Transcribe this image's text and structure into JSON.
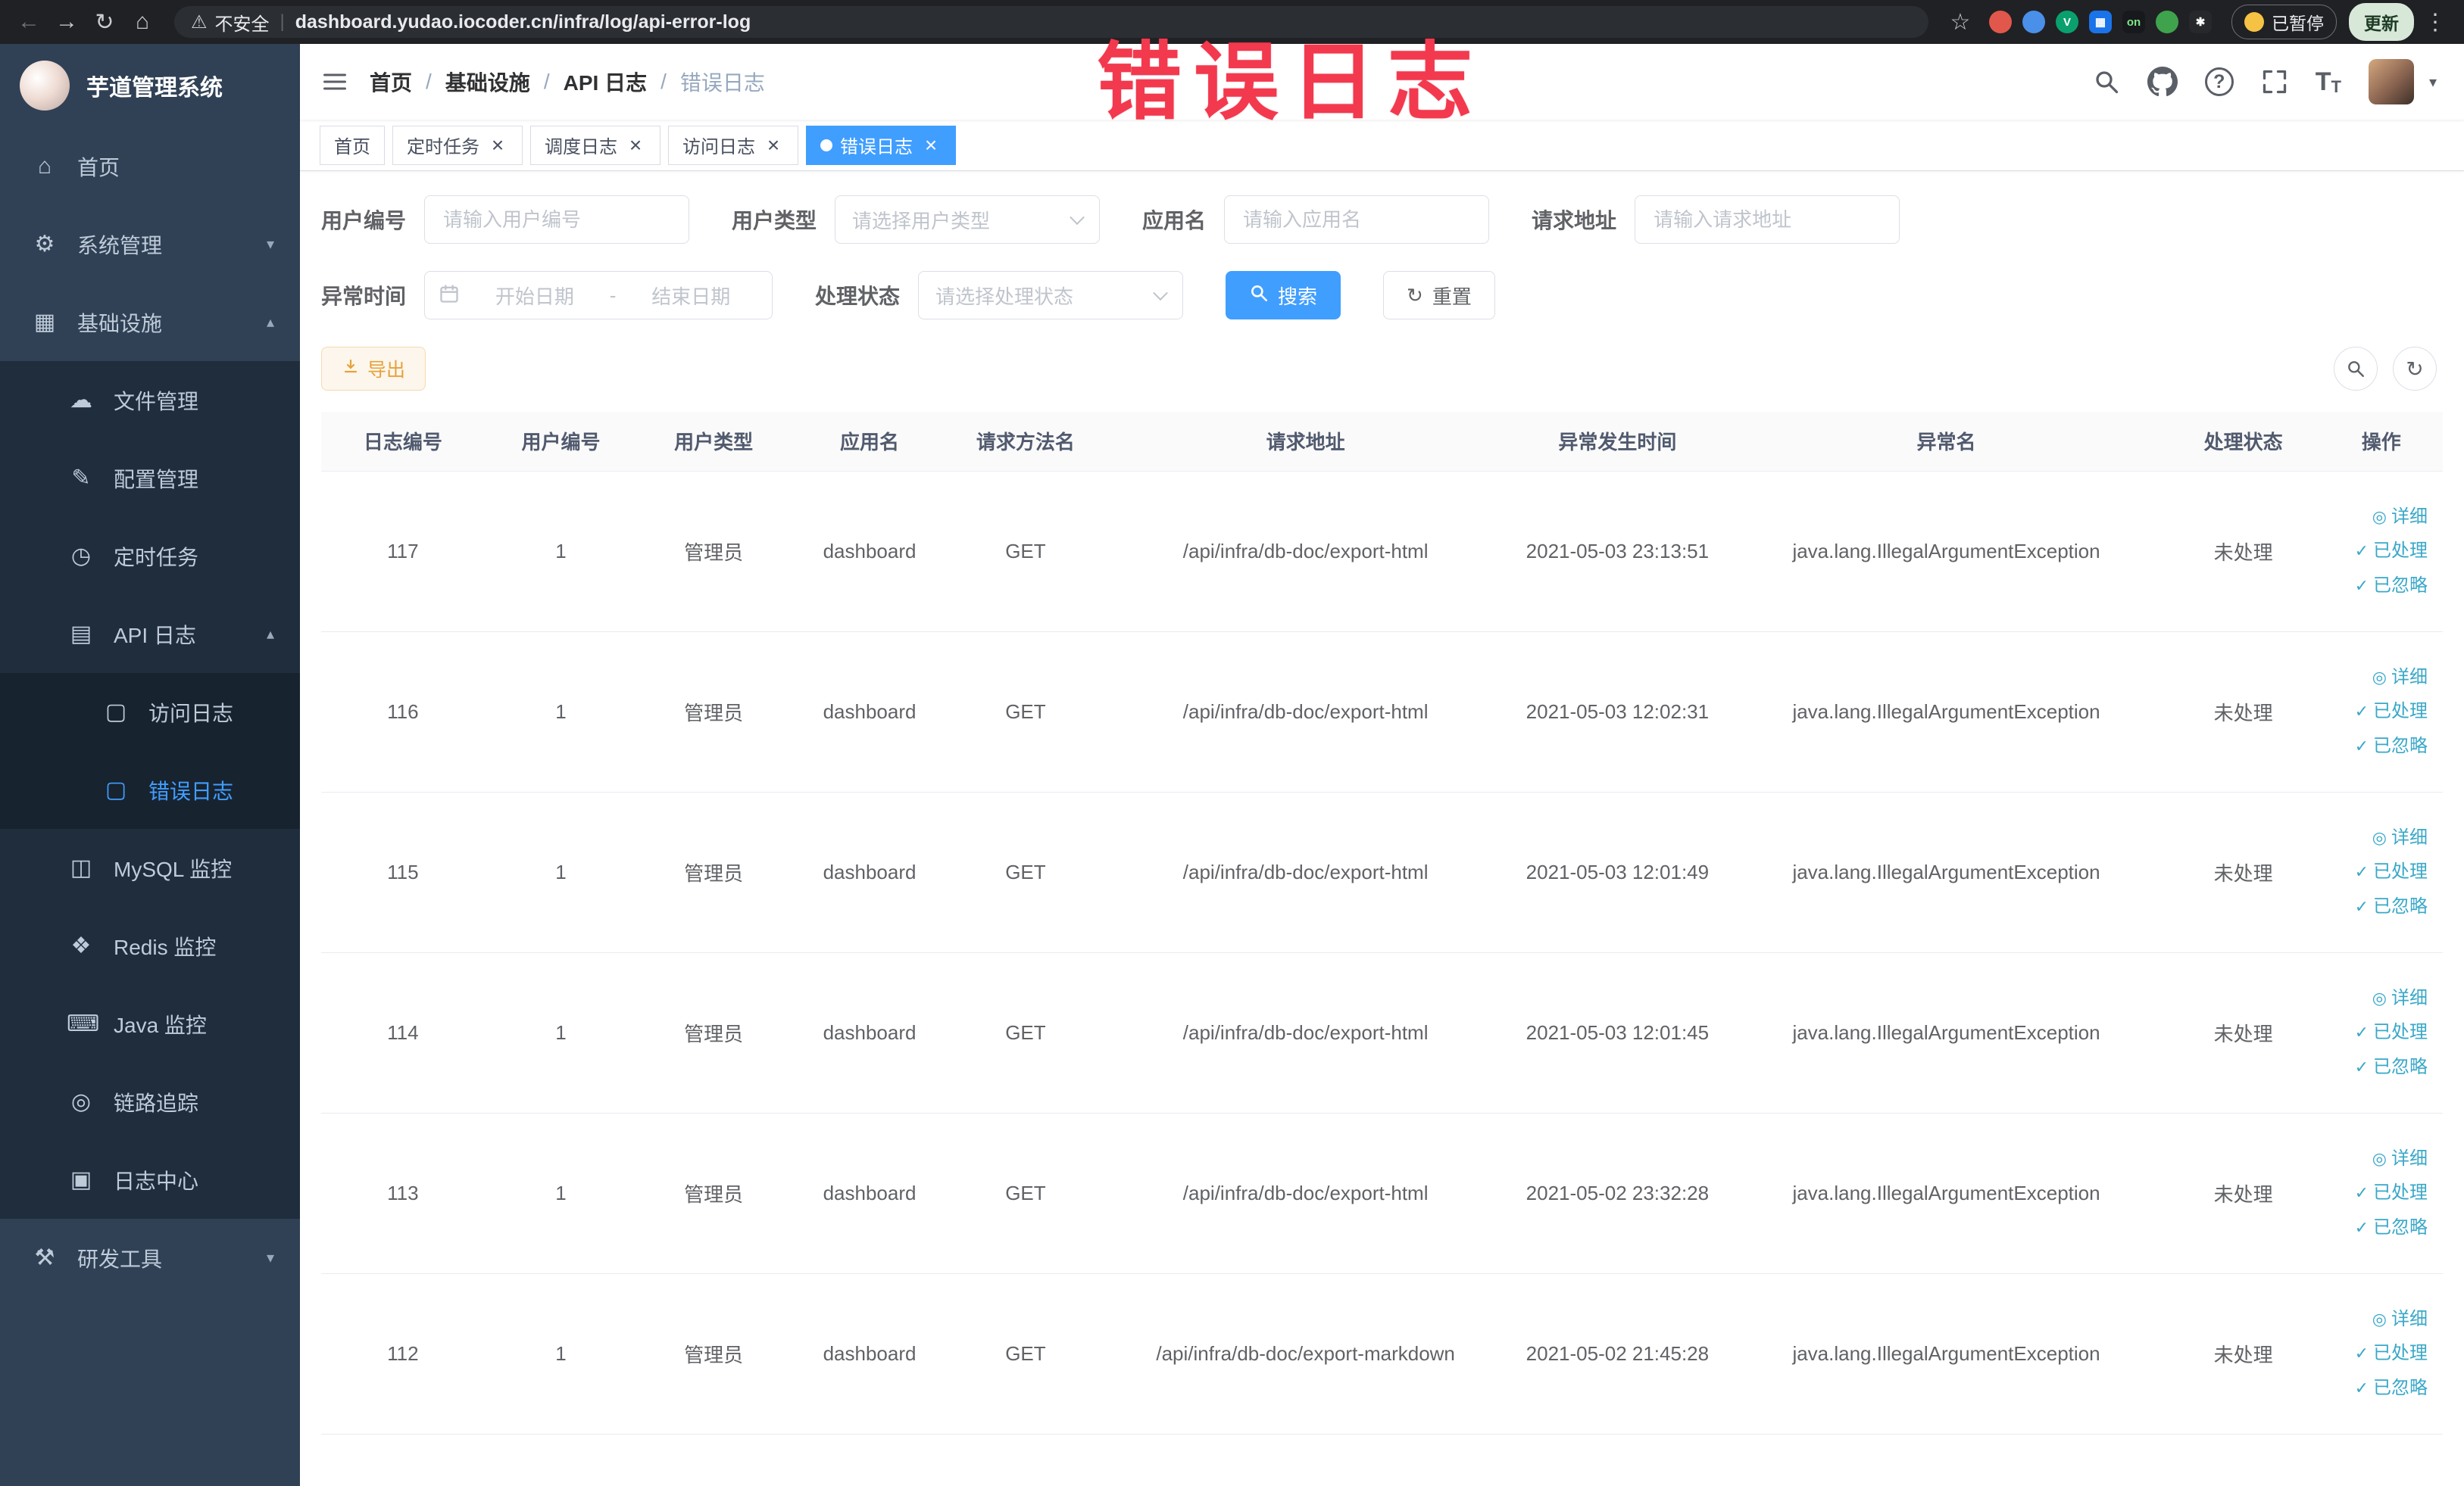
{
  "colors": {
    "accent": "#409EFF",
    "link": "#3aa8c8",
    "sidebar-bg": "#304156",
    "sidebar-sub-bg": "#1f2d3d",
    "warning": "#e6a23c",
    "watermark": "#f2394e",
    "chrome-bg": "#202124"
  },
  "browser": {
    "security_label": "不安全",
    "url": "dashboard.yudao.iocoder.cn/infra/log/api-error-log",
    "paused_chip": "已暂停",
    "update_button": "更新",
    "extensions": [
      {
        "color": "#e1574c",
        "shape": "circle",
        "text": ""
      },
      {
        "color": "#4a8fe8",
        "shape": "circle",
        "text": ""
      },
      {
        "color": "#0aa06e",
        "shape": "circle",
        "text": "V"
      },
      {
        "color": "#1a73e8",
        "shape": "square",
        "text": "▦"
      },
      {
        "color": "#17191c",
        "shape": "square",
        "text": "on",
        "text_color": "#7ee787"
      },
      {
        "color": "#3fa34d",
        "shape": "circle",
        "text": ""
      },
      {
        "color": "#26282c",
        "shape": "square",
        "text": "✱"
      }
    ]
  },
  "watermark": "错误日志",
  "sidebar": {
    "title": "芋道管理系统",
    "menu": [
      {
        "label": "首页",
        "icon": "home"
      },
      {
        "label": "系统管理",
        "icon": "gear",
        "has_children": true,
        "expanded": false
      },
      {
        "label": "基础设施",
        "icon": "grid",
        "expanded": true,
        "children": [
          {
            "label": "文件管理",
            "icon": "cloud"
          },
          {
            "label": "配置管理",
            "icon": "pencil"
          },
          {
            "label": "定时任务",
            "icon": "timer"
          },
          {
            "label": "API 日志",
            "icon": "doc",
            "expanded": true,
            "children": [
              {
                "label": "访问日志",
                "icon": "doc-small"
              },
              {
                "label": "错误日志",
                "icon": "doc-small",
                "active": true
              }
            ]
          },
          {
            "label": "MySQL 监控",
            "icon": "mysql"
          },
          {
            "label": "Redis 监控",
            "icon": "redis"
          },
          {
            "label": "Java 监控",
            "icon": "java"
          },
          {
            "label": "链路追踪",
            "icon": "trace"
          },
          {
            "label": "日志中心",
            "icon": "log"
          }
        ]
      },
      {
        "label": "研发工具",
        "icon": "tools",
        "has_children": true,
        "expanded": false
      }
    ]
  },
  "header": {
    "breadcrumb": [
      "首页",
      "基础设施",
      "API 日志",
      "错误日志"
    ]
  },
  "tabs": [
    {
      "label": "首页",
      "closable": false,
      "active": false
    },
    {
      "label": "定时任务",
      "closable": true,
      "active": false
    },
    {
      "label": "调度日志",
      "closable": true,
      "active": false
    },
    {
      "label": "访问日志",
      "closable": true,
      "active": false
    },
    {
      "label": "错误日志",
      "closable": true,
      "active": true
    }
  ],
  "filters": {
    "user_id": {
      "label": "用户编号",
      "placeholder": "请输入用户编号"
    },
    "user_type": {
      "label": "用户类型",
      "placeholder": "请选择用户类型"
    },
    "app_name": {
      "label": "应用名",
      "placeholder": "请输入应用名"
    },
    "request_url": {
      "label": "请求地址",
      "placeholder": "请输入请求地址"
    },
    "exception_time": {
      "label": "异常时间",
      "start_placeholder": "开始日期",
      "separator": "-",
      "end_placeholder": "结束日期"
    },
    "process_status": {
      "label": "处理状态",
      "placeholder": "请选择处理状态"
    },
    "search_label": "搜索",
    "reset_label": "重置"
  },
  "toolbar": {
    "export_label": "导出"
  },
  "table": {
    "columns": [
      "日志编号",
      "用户编号",
      "用户类型",
      "应用名",
      "请求方法名",
      "请求地址",
      "异常发生时间",
      "异常名",
      "处理状态",
      "操作"
    ],
    "actions": {
      "detail": "详细",
      "processed": "已处理",
      "ignored": "已忽略"
    },
    "rows": [
      {
        "id": "117",
        "user_id": "1",
        "user_type": "管理员",
        "app": "dashboard",
        "method": "GET",
        "url": "/api/infra/db-doc/export-html",
        "time": "2021-05-03 23:13:51",
        "exception": "java.lang.IllegalArgumentException",
        "status": "未处理"
      },
      {
        "id": "116",
        "user_id": "1",
        "user_type": "管理员",
        "app": "dashboard",
        "method": "GET",
        "url": "/api/infra/db-doc/export-html",
        "time": "2021-05-03 12:02:31",
        "exception": "java.lang.IllegalArgumentException",
        "status": "未处理"
      },
      {
        "id": "115",
        "user_id": "1",
        "user_type": "管理员",
        "app": "dashboard",
        "method": "GET",
        "url": "/api/infra/db-doc/export-html",
        "time": "2021-05-03 12:01:49",
        "exception": "java.lang.IllegalArgumentException",
        "status": "未处理"
      },
      {
        "id": "114",
        "user_id": "1",
        "user_type": "管理员",
        "app": "dashboard",
        "method": "GET",
        "url": "/api/infra/db-doc/export-html",
        "time": "2021-05-03 12:01:45",
        "exception": "java.lang.IllegalArgumentException",
        "status": "未处理"
      },
      {
        "id": "113",
        "user_id": "1",
        "user_type": "管理员",
        "app": "dashboard",
        "method": "GET",
        "url": "/api/infra/db-doc/export-html",
        "time": "2021-05-02 23:32:28",
        "exception": "java.lang.IllegalArgumentException",
        "status": "未处理"
      },
      {
        "id": "112",
        "user_id": "1",
        "user_type": "管理员",
        "app": "dashboard",
        "method": "GET",
        "url": "/api/infra/db-doc/export-markdown",
        "time": "2021-05-02 21:45:28",
        "exception": "java.lang.IllegalArgumentException",
        "status": "未处理"
      }
    ]
  }
}
